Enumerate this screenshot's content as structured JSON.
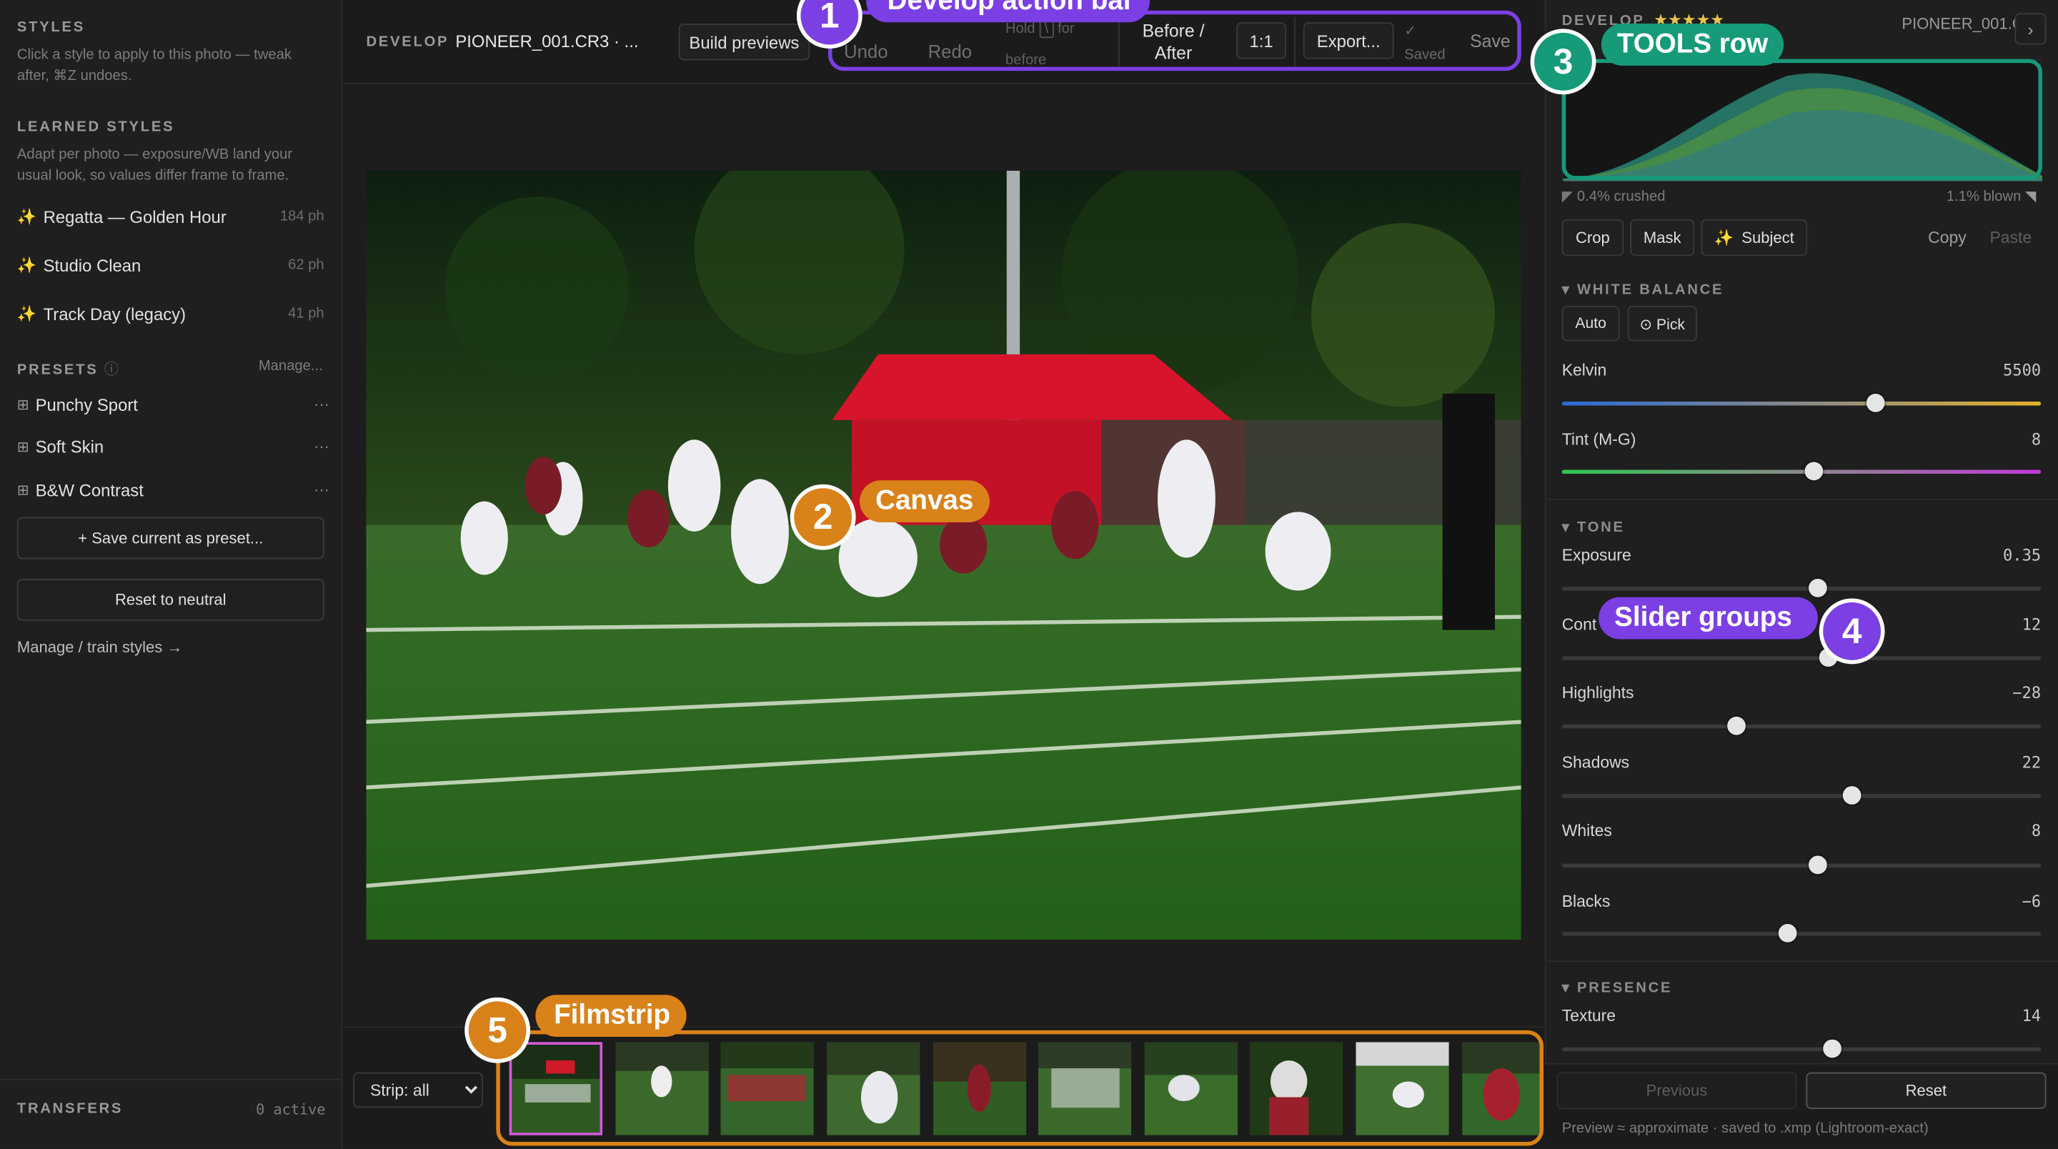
{
  "left": {
    "styles_title": "STYLES",
    "styles_hint": "Click a style to apply to this photo — tweak after, ⌘Z undoes.",
    "learned_title": "LEARNED STYLES",
    "learned_hint": "Adapt per photo — exposure/WB land your usual look, so values differ frame to frame.",
    "learned": [
      {
        "name": "Regatta — Golden Hour",
        "count": "184 ph"
      },
      {
        "name": "Studio Clean",
        "count": "62 ph"
      },
      {
        "name": "Track Day (legacy)",
        "count": "41 ph"
      }
    ],
    "presets_title": "PRESETS",
    "presets_info": "ⓘ",
    "presets_manage": "Manage...",
    "presets": [
      {
        "name": "Punchy Sport",
        "more": "···"
      },
      {
        "name": "Soft Skin",
        "more": "···"
      },
      {
        "name": "B&W Contrast",
        "more": "···"
      }
    ],
    "save_preset": "+ Save current as preset...",
    "reset_neutral": "Reset to neutral",
    "manage_train": "Manage / train styles →",
    "transfers_title": "TRANSFERS",
    "transfers_status": "0 active"
  },
  "topbar": {
    "mode": "DEVELOP",
    "filename": "PIONEER_001.CR3 · ...",
    "build_previews": "Build previews",
    "undo": "Undo",
    "redo": "Redo",
    "hold_hint_a": "Hold",
    "hold_key": "\\",
    "hold_hint_b": "for",
    "hold_hint_c": "before",
    "before_after_1": "Before /",
    "before_after_2": "After",
    "one_to_one": "1:1",
    "export": "Export...",
    "saved_check": "✓",
    "saved": "Saved",
    "save": "Save"
  },
  "filmstrip": {
    "filter": "Strip: all",
    "filter_options": [
      "Strip: all"
    ]
  },
  "right": {
    "mode": "DEVELOP",
    "stars": "★★★★★",
    "filename": "PIONEER_001.C",
    "next": "›",
    "crushed": "0.4% crushed",
    "blown": "1.1% blown",
    "tools": {
      "crop": "Crop",
      "mask": "Mask",
      "subject_icon": "✨",
      "subject": "Subject",
      "copy": "Copy",
      "paste": "Paste"
    },
    "wb_title": "▾ WHITE BALANCE",
    "wb_auto": "Auto",
    "wb_pick": "⊙ Pick",
    "kelvin": {
      "label": "Kelvin",
      "value": "5500",
      "pos": 0.655
    },
    "tint": {
      "label": "Tint (M-G)",
      "value": "8",
      "pos": 0.525
    },
    "tone_title": "▾ TONE",
    "exposure": {
      "label": "Exposure",
      "value": "0.35",
      "pos": 0.535
    },
    "contrast": {
      "label": "Cont",
      "value": "12",
      "pos": 0.555
    },
    "highlights": {
      "label": "Highlights",
      "value": "−28",
      "pos": 0.365
    },
    "shadows": {
      "label": "Shadows",
      "value": "22",
      "pos": 0.605
    },
    "whites": {
      "label": "Whites",
      "value": "8",
      "pos": 0.535
    },
    "blacks": {
      "label": "Blacks",
      "value": "−6",
      "pos": 0.47
    },
    "presence_title": "▾ PRESENCE",
    "texture": {
      "label": "Texture",
      "value": "14",
      "pos": 0.565
    },
    "previous": "Previous",
    "reset": "Reset",
    "footnote": "Preview ≈ approximate · saved to .xmp (Lightroom-exact)"
  },
  "callouts": [
    {
      "num": "1",
      "label": "Develop action bar"
    },
    {
      "num": "2",
      "label": "Canvas"
    },
    {
      "num": "3",
      "label": "TOOLS row"
    },
    {
      "num": "4",
      "label": "Slider groups"
    },
    {
      "num": "5",
      "label": "Filmstrip"
    }
  ],
  "colors": {
    "callout_purple": "#7b3fe4",
    "callout_orange": "#d9821a",
    "callout_green": "#169a7a"
  }
}
